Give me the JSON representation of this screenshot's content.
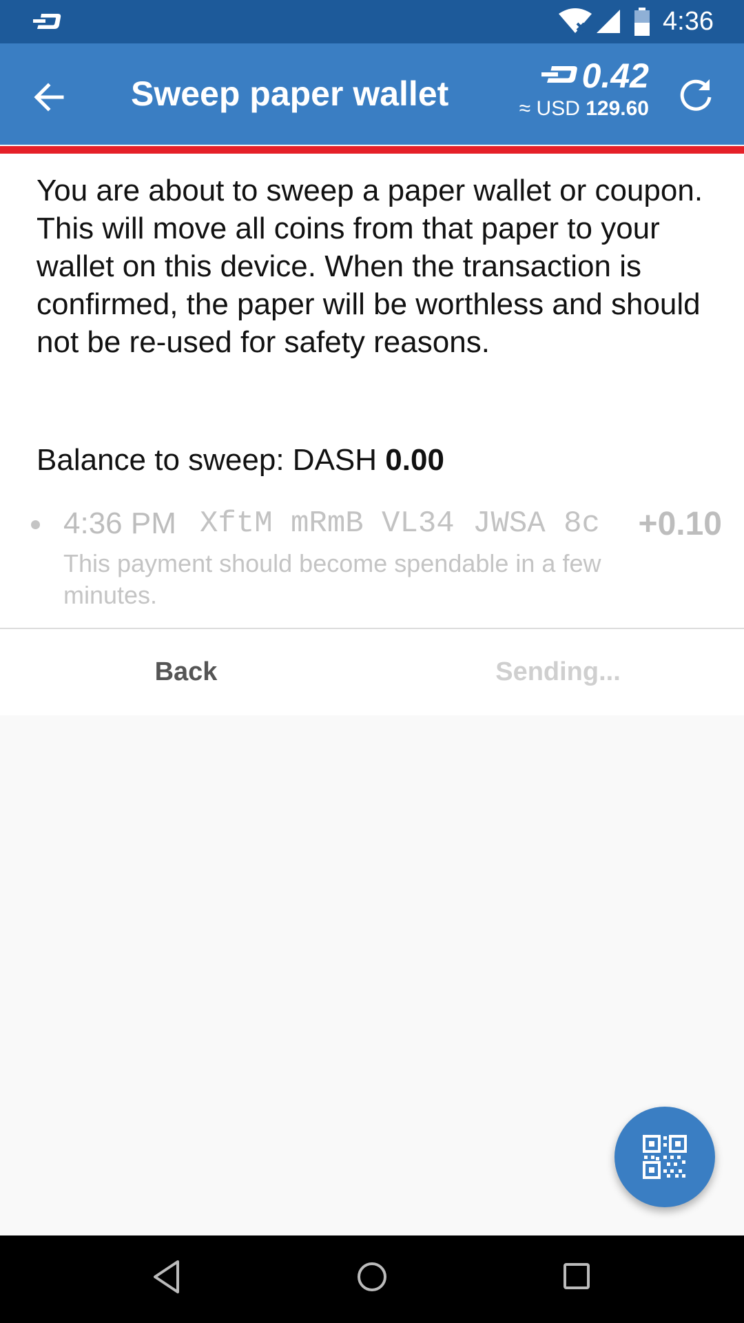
{
  "status_bar": {
    "time": "4:36",
    "notification_icon": "dash-logo-icon",
    "wifi_icon": "wifi-icon",
    "signal_icon": "cell-signal-icon",
    "battery_icon": "battery-icon"
  },
  "app_bar": {
    "back_icon": "arrow-back-icon",
    "title": "Sweep paper wallet",
    "balance": {
      "currency_icon": "dash-currency-icon",
      "amount": "0.42",
      "fiat_prefix": "≈ USD",
      "fiat_value": "129.60"
    },
    "refresh_icon": "refresh-icon"
  },
  "colors": {
    "status_bar": "#1d5a9a",
    "app_bar": "#3a7ec3",
    "accent_line": "#e52028",
    "fab": "#3a7ec3"
  },
  "content": {
    "intro": "You are about to sweep a paper wallet or coupon. This will move all coins from that paper to your wallet on this device. When the transaction is confirmed, the paper will be worthless and should not be re-used for safety reasons.",
    "balance_label": "Balance to sweep: DASH",
    "balance_value": "0.00",
    "transaction": {
      "time": "4:36 PM",
      "address": "XftM mRmB VL34 JWSA 8c…",
      "amount": "+0.10",
      "note": "This payment should become spendable in a few minutes."
    }
  },
  "buttons": {
    "back": "Back",
    "sending": "Sending..."
  },
  "fab": {
    "icon": "qr-code-icon"
  },
  "nav_bar": {
    "back_icon": "nav-back-icon",
    "home_icon": "nav-home-icon",
    "recents_icon": "nav-recents-icon"
  }
}
